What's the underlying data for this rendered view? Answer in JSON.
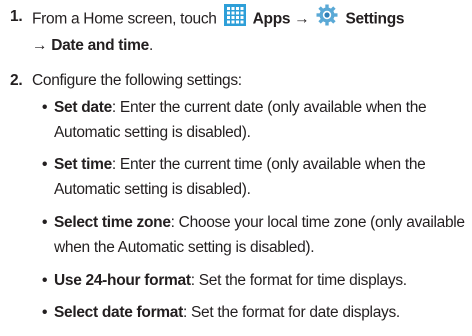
{
  "steps": [
    {
      "number": "1.",
      "line1_prefix": "From a Home screen, touch",
      "apps_label": "Apps",
      "arrow": "→",
      "settings_label": "Settings",
      "line2": "→ Date and time",
      "line2_end": "."
    },
    {
      "number": "2.",
      "intro": "Configure the following settings:",
      "bullets": [
        {
          "term": "Set date",
          "line1": ": Enter the current date (only available when the",
          "line2": "Automatic setting is disabled)."
        },
        {
          "term": "Set time",
          "line1": ": Enter the current time (only available when the",
          "line2": "Automatic setting is disabled)."
        },
        {
          "term": "Select time zone",
          "line1": ": Choose your local time zone (only available",
          "line2": "when the Automatic setting is disabled)."
        },
        {
          "term": "Use 24-hour format",
          "line1": ": Set the format for time displays.",
          "line2": ""
        },
        {
          "term": "Select date format",
          "line1": ": Set the format for date displays.",
          "line2": ""
        }
      ]
    }
  ],
  "icons": {
    "apps": "apps-grid-icon",
    "settings": "settings-gear-icon"
  },
  "colors": {
    "apps_icon": "#2e9fd8",
    "settings_icon": "#5aa9d6",
    "text": "#231f20"
  }
}
